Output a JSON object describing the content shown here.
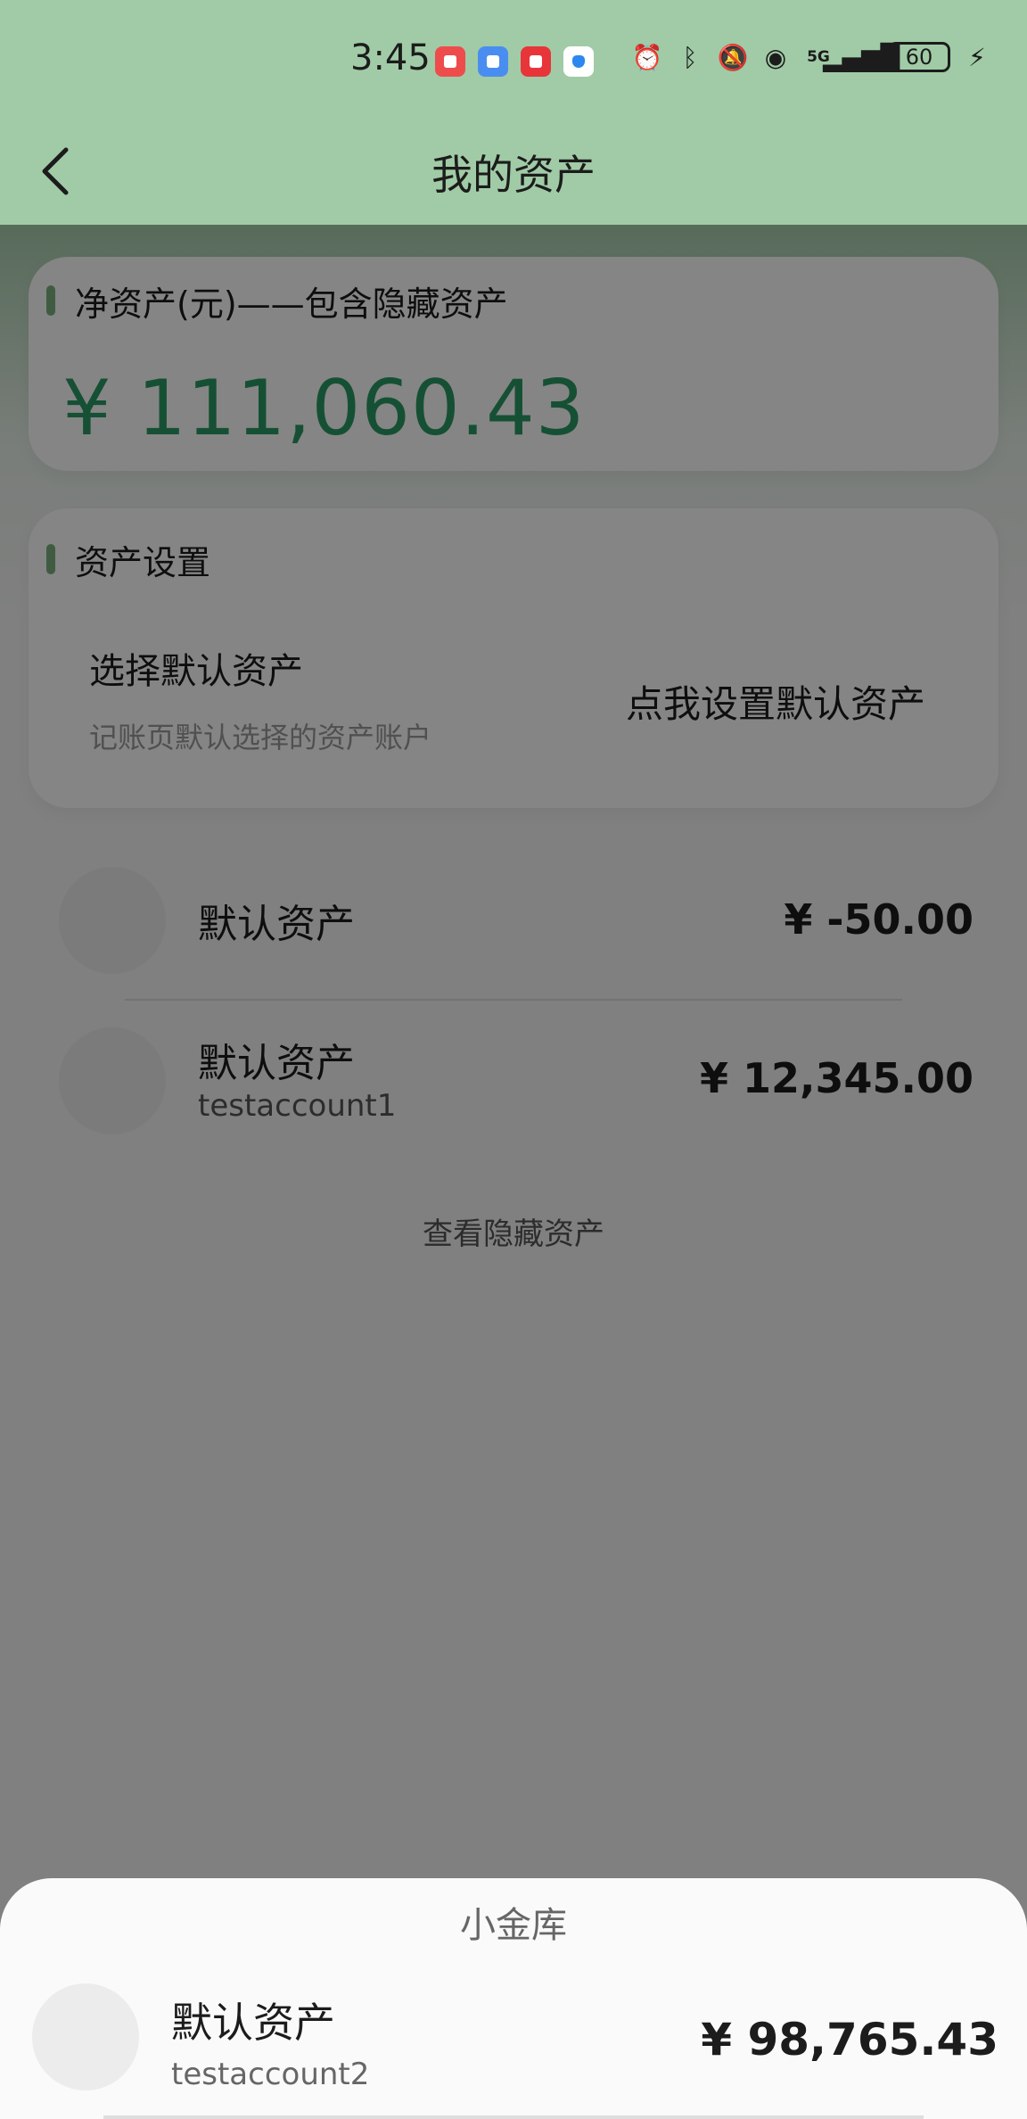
{
  "status_bar": {
    "time": "3:45",
    "battery": "60",
    "network": "5G",
    "colors": {
      "background": "#a0cba6"
    }
  },
  "nav": {
    "title": "我的资产",
    "back_icon": "chevron-left-icon"
  },
  "net_assets": {
    "label": "净资产(元)——包含隐藏资产",
    "amount": "¥ 111,060.43",
    "accent_color": "#2b9a65"
  },
  "settings": {
    "section_label": "资产设置",
    "option_title": "选择默认资产",
    "option_subtitle": "记账页默认选择的资产账户",
    "action_label": "点我设置默认资产"
  },
  "assets": [
    {
      "name": "默认资产",
      "account": "",
      "amount": "¥ -50.00"
    },
    {
      "name": "默认资产",
      "account": "testaccount1",
      "amount": "¥ 12,345.00"
    }
  ],
  "hidden_assets_link": "查看隐藏资产",
  "sheet": {
    "title": "小金库",
    "item": {
      "name": "默认资产",
      "account": "testaccount2",
      "amount": "¥ 98,765.43"
    }
  }
}
